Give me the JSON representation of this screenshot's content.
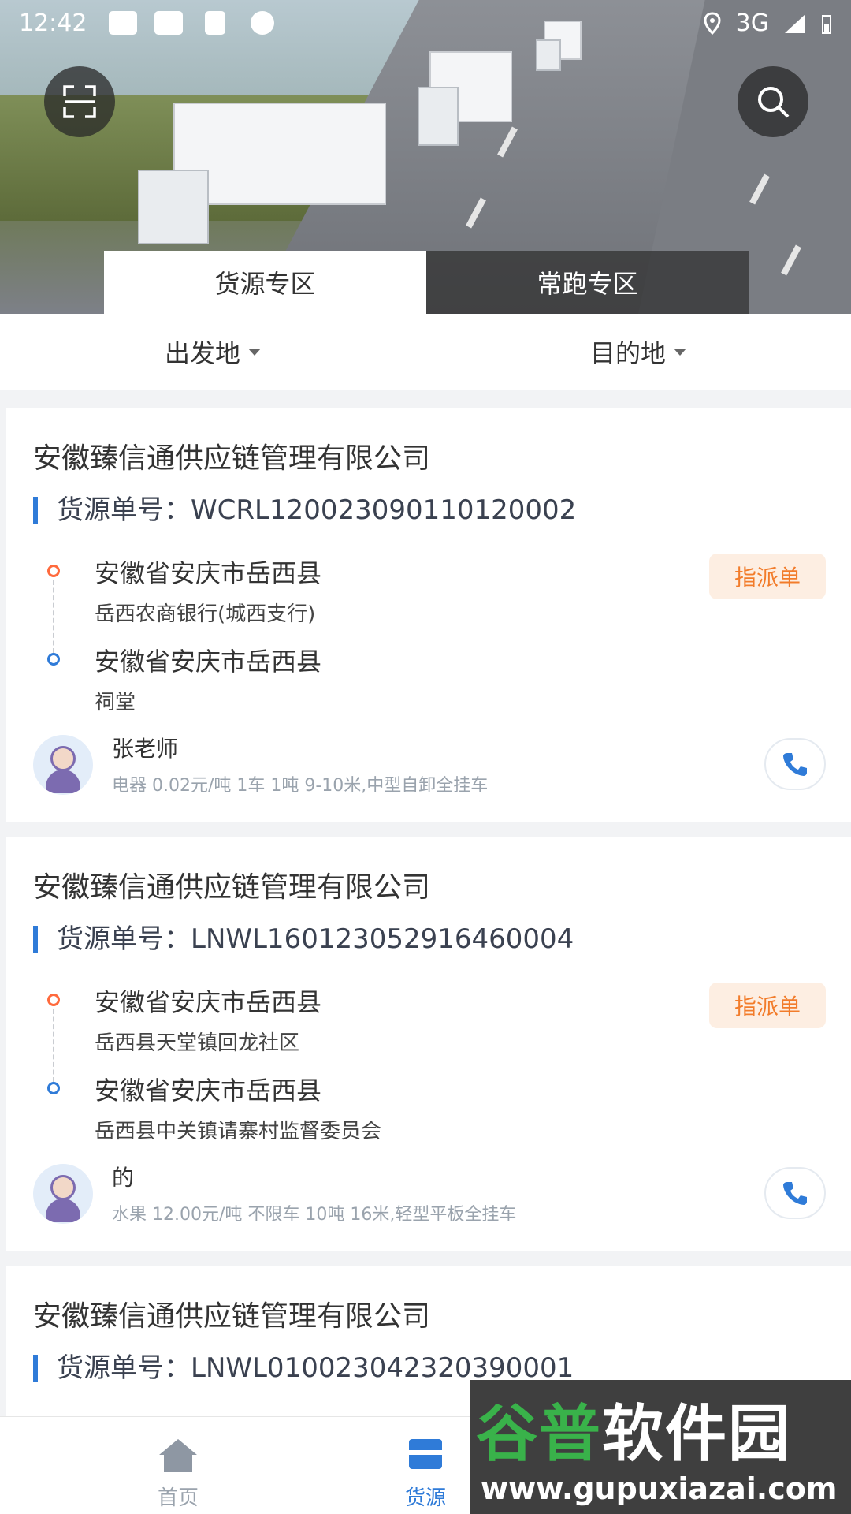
{
  "status_bar": {
    "time": "12:42",
    "network": "3G"
  },
  "header": {
    "scan_icon": "scan-icon",
    "search_icon": "search-icon",
    "tabs": [
      {
        "label": "货源专区",
        "active": true
      },
      {
        "label": "常跑专区",
        "active": false
      }
    ]
  },
  "filters": {
    "origin": "出发地",
    "destination": "目的地"
  },
  "cards": [
    {
      "company": "安徽臻信通供应链管理有限公司",
      "order_no": "货源单号：WCRL12002309011012000​2",
      "from_province": "安徽省安庆市岳西县",
      "from_address": "岳西农商银行(城西支行)",
      "to_province": "安徽省安庆市岳西县",
      "to_address": "祠堂",
      "badge": "指派单",
      "contact": "张老师",
      "cargo": "电器 0.02元/吨 1车 1吨 9-10米,中型自卸全挂车"
    },
    {
      "company": "安徽臻信通供应链管理有限公司",
      "order_no": "货源单号：LNWL16012305291646000​4",
      "from_province": "安徽省安庆市岳西县",
      "from_address": "岳西县天堂镇回龙社区",
      "to_province": "安徽省安庆市岳西县",
      "to_address": "岳西县中关镇请寨村监督委员会",
      "badge": "指派单",
      "contact": "的",
      "cargo": "水果 12.00元/吨 不限车 10吨 16米,轻型平板全挂车"
    },
    {
      "company": "安徽臻信通供应链管理有限公司",
      "order_no": "货源单号：LNWL01002304232039000​1"
    }
  ],
  "bottom_nav": [
    {
      "label": "首页",
      "icon": "home-icon",
      "active": false
    },
    {
      "label": "货源",
      "icon": "cargo-icon",
      "active": true
    }
  ],
  "watermark": {
    "text_green": "谷普",
    "text_white": "软件园",
    "url": "www.gupuxiazai.com"
  },
  "colors": {
    "accent": "#2f7bd8",
    "badge": "#f27c2b",
    "origin_dot": "#ff6a3d"
  }
}
